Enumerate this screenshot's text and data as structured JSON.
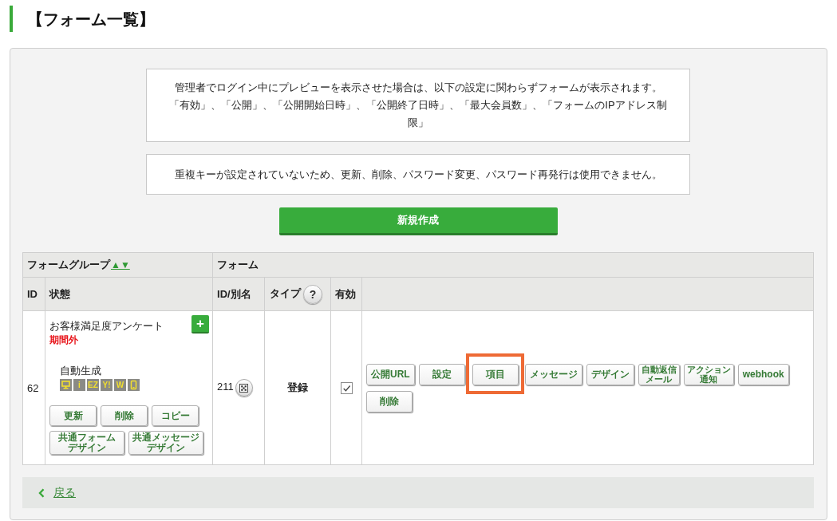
{
  "page_title": "【フォーム一覧】",
  "notices": [
    {
      "lines": [
        "管理者でログイン中にプレビューを表示させた場合は、以下の設定に関わらずフォームが表示されます。",
        "「有効」、「公開」、「公開開始日時」、「公開終了日時」、「最大会員数」、「フォームのIPアドレス制限」"
      ]
    },
    {
      "lines": [
        "重複キーが設定されていないため、更新、削除、パスワード変更、パスワード再発行は使用できません。"
      ]
    }
  ],
  "new_button": "新規作成",
  "table": {
    "group_header": {
      "label": "フォームグループ",
      "sort_link": "▲▼"
    },
    "form_header": "フォーム",
    "columns": [
      {
        "label": "ID"
      },
      {
        "label": "状態"
      },
      {
        "label": "ID/別名"
      },
      {
        "label": "タイプ",
        "help": "?"
      },
      {
        "label": "有効"
      }
    ],
    "rows": [
      {
        "id": "62",
        "group_name": "お客様満足度アンケート",
        "add_button": "+",
        "period_status": "期間外",
        "generation": "自動生成",
        "device_tags": [
          {
            "kind": "monitor"
          },
          {
            "kind": "text",
            "label": "i"
          },
          {
            "kind": "text",
            "label": "EZ"
          },
          {
            "kind": "text",
            "label": "Y!"
          },
          {
            "kind": "text",
            "label": "W"
          },
          {
            "kind": "phone"
          }
        ],
        "group_buttons": [
          {
            "lines": [
              "更新"
            ]
          },
          {
            "lines": [
              "削除"
            ]
          },
          {
            "lines": [
              "コピー"
            ]
          },
          {
            "lines": [
              "共通フォーム",
              "デザイン"
            ]
          },
          {
            "lines": [
              "共通メッセージ",
              "デザイン"
            ]
          }
        ],
        "form_id": "211",
        "type": "登録",
        "enabled": true,
        "form_buttons": [
          {
            "lines": [
              "公開URL"
            ],
            "highlighted": false
          },
          {
            "lines": [
              "設定"
            ],
            "highlighted": false
          },
          {
            "lines": [
              "項目"
            ],
            "highlighted": true
          },
          {
            "lines": [
              "メッセージ"
            ],
            "highlighted": false
          },
          {
            "lines": [
              "デザイン"
            ],
            "highlighted": false
          },
          {
            "lines": [
              "自動返信",
              "メール"
            ],
            "highlighted": false
          },
          {
            "lines": [
              "アクション",
              "通知"
            ],
            "highlighted": false
          },
          {
            "lines": [
              "webhook"
            ],
            "highlighted": false
          },
          {
            "lines": [
              "削除"
            ],
            "highlighted": false
          }
        ]
      }
    ]
  },
  "back_link": "戻る"
}
